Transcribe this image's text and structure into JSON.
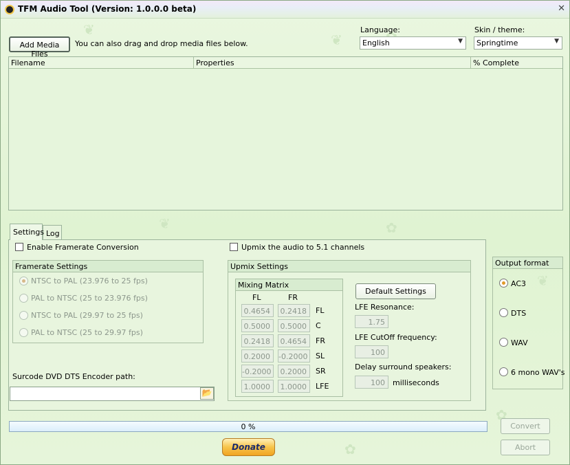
{
  "window": {
    "title": "TFM Audio Tool   (Version: 1.0.0.0 beta)",
    "close_glyph": "✕"
  },
  "top": {
    "add_button": "Add Media Files",
    "hint": "You can also drag and drop media files below.",
    "language_label": "Language:",
    "language_value": "English",
    "skin_label": "Skin / theme:",
    "skin_value": "Springtime"
  },
  "grid": {
    "columns": [
      "Filename",
      "Properties",
      "% Complete"
    ]
  },
  "tabs": [
    "Settings",
    "Log"
  ],
  "settings": {
    "enable_framerate": "Enable Framerate Conversion",
    "upmix_check": "Upmix the audio to 5.1 channels",
    "framerate_group": "Framerate Settings",
    "framerate_options": [
      "NTSC to PAL (23.976 to 25 fps)",
      "PAL to NTSC (25 to 23.976 fps)",
      "NTSC to PAL (29.97 to 25 fps)",
      "PAL to NTSC (25 to 29.97 fps)"
    ],
    "encoder_label": "Surcode DVD DTS Encoder path:",
    "upmix_group": "Upmix Settings",
    "mixing_group": "Mixing Matrix",
    "matrix_cols": [
      "FL",
      "FR"
    ],
    "matrix_rows": [
      {
        "fl": "0.4654",
        "fr": "0.2418",
        "label": "FL"
      },
      {
        "fl": "0.5000",
        "fr": "0.5000",
        "label": "C"
      },
      {
        "fl": "0.2418",
        "fr": "0.4654",
        "label": "FR"
      },
      {
        "fl": "0.2000",
        "fr": "-0.2000",
        "label": "SL"
      },
      {
        "fl": "-0.2000",
        "fr": "0.2000",
        "label": "SR"
      },
      {
        "fl": "1.0000",
        "fr": "1.0000",
        "label": "LFE"
      }
    ],
    "default_button": "Default Settings",
    "lfe_resonance_label": "LFE Resonance:",
    "lfe_resonance_value": "1.75",
    "lfe_cutoff_label": "LFE CutOff frequency:",
    "lfe_cutoff_value": "100",
    "delay_label": "Delay surround speakers:",
    "delay_value": "100",
    "delay_unit": "milliseconds"
  },
  "output": {
    "title": "Output format",
    "options": [
      "AC3",
      "DTS",
      "WAV",
      "6 mono WAV's"
    ],
    "selected": "AC3"
  },
  "progress": {
    "text": "0 %",
    "value": 0
  },
  "buttons": {
    "convert": "Convert",
    "abort": "Abort",
    "donate": "Donate"
  }
}
